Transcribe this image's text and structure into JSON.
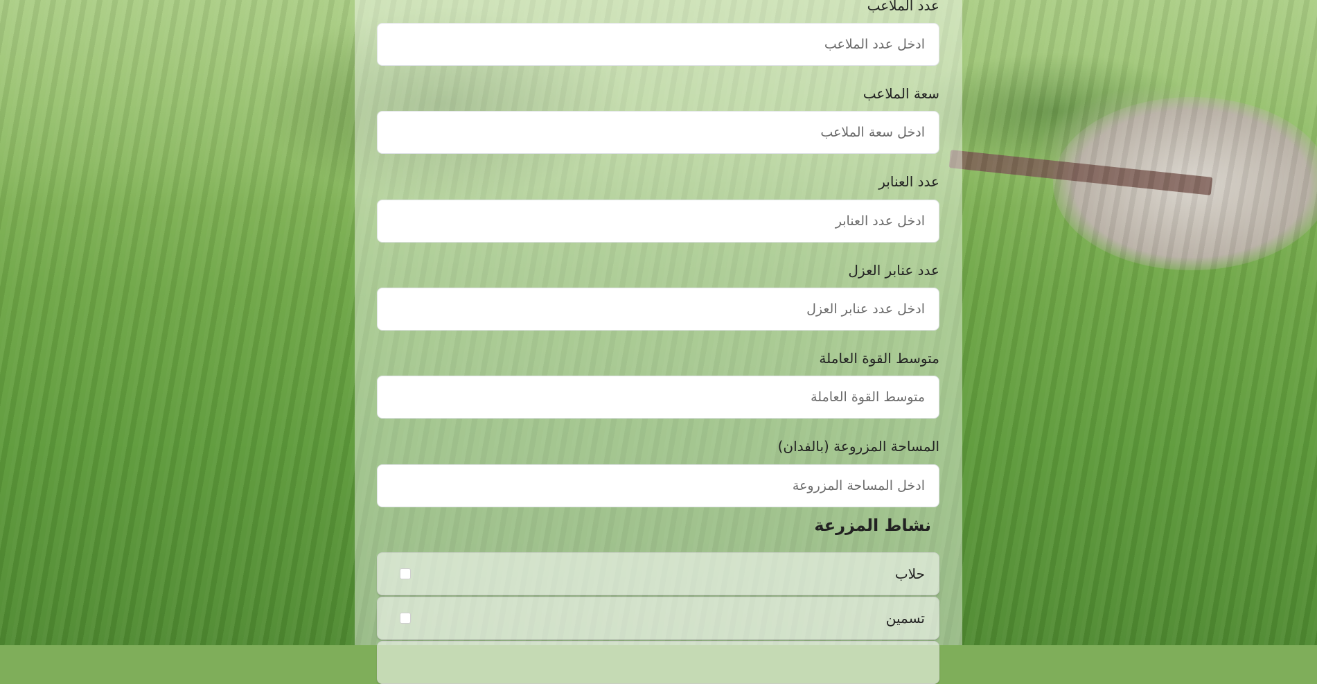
{
  "form": {
    "fields": [
      {
        "label": "عدد الملاعب",
        "placeholder": "ادخل عدد الملاعب"
      },
      {
        "label": "سعة الملاعب",
        "placeholder": "ادخل سعة الملاعب"
      },
      {
        "label": "عدد العنابر",
        "placeholder": "ادخل عدد العنابر"
      },
      {
        "label": "عدد عنابر العزل",
        "placeholder": "ادخل عدد عنابر العزل"
      },
      {
        "label": "متوسط القوة العاملة",
        "placeholder": "متوسط القوة العاملة"
      },
      {
        "label": "المساحة المزروعة (بالفدان)",
        "placeholder": "ادخل المساحة المزروعة"
      }
    ],
    "activity_title": "نشاط المزرعة",
    "activities": [
      {
        "label": "حلاب"
      },
      {
        "label": "تسمين"
      }
    ]
  },
  "colors": {
    "panel_overlay": "#ffffff",
    "input_background": "#ffffff",
    "text": "#222222",
    "placeholder": "#6b6b6b"
  },
  "icons": {
    "checkbox": "unchecked-checkbox"
  }
}
